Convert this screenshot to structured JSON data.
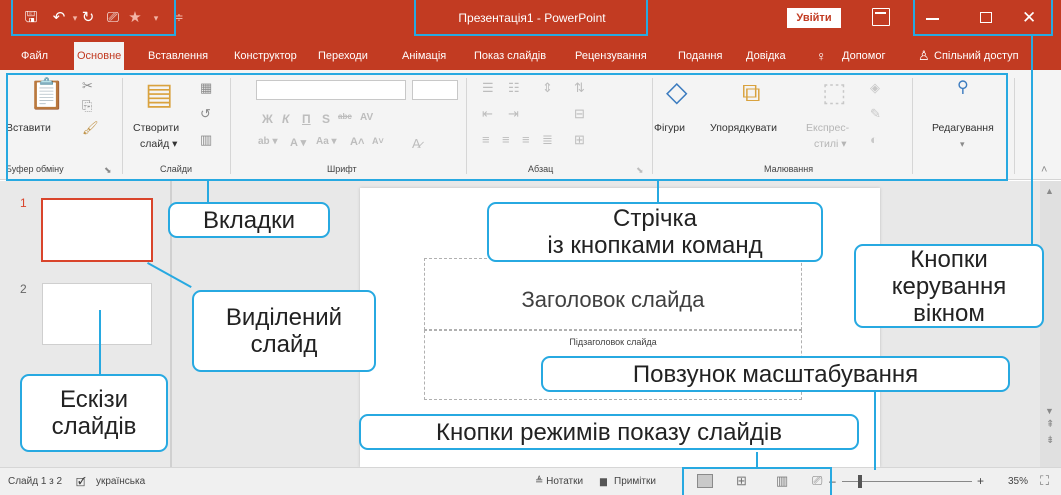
{
  "titlebar": {
    "document_title": "Презентація1  -  PowerPoint",
    "login_label": "Увійти",
    "close_glyph": "✕"
  },
  "tabs": [
    {
      "label": "Файл"
    },
    {
      "label": "Основне",
      "active": true
    },
    {
      "label": "Вставлення"
    },
    {
      "label": "Конструктор"
    },
    {
      "label": "Переходи"
    },
    {
      "label": "Анімація"
    },
    {
      "label": "Показ слайдів"
    },
    {
      "label": "Рецензування"
    },
    {
      "label": "Подання"
    },
    {
      "label": "Довідка"
    },
    {
      "label": "Допомог"
    },
    {
      "label": "Спільний доступ"
    }
  ],
  "ribbon": {
    "paste_label": "Вставити",
    "new_slide_label_1": "Створити",
    "new_slide_label_2": "слайд ▾",
    "shapes_label": "Фігури",
    "arrange_label": "Упорядкувати",
    "quick_styles_label_1": "Експрес-",
    "quick_styles_label_2": "стилі ▾",
    "editing_label": "Редагування",
    "groups": {
      "clipboard": "Буфер обміну",
      "slides": "Слайди",
      "font": "Шрифт",
      "paragraph": "Абзац",
      "drawing": "Малювання"
    },
    "font_buttons": [
      "Ж",
      "К",
      "П",
      "S",
      "abc",
      "AV"
    ],
    "font_buttons_row2": [
      "ab ▾",
      "A ▾",
      "Aa ▾",
      "A˄",
      "A˅"
    ]
  },
  "slides": [
    {
      "number": "1",
      "selected": true
    },
    {
      "number": "2",
      "selected": false
    }
  ],
  "slide": {
    "title_placeholder": "Заголовок слайда",
    "subtitle_placeholder": "Підзаголовок слайда"
  },
  "statusbar": {
    "slide_counter": "Слайд 1 з 2",
    "language": "українська",
    "notes_label": "≜ Нотатки",
    "comments_label": "Примітки",
    "zoom_minus": "–",
    "zoom_plus": "+",
    "zoom_value": "35%",
    "zoom_level_percent": 35
  },
  "callouts": {
    "tabs": "Вкладки",
    "ribbon_line1": "Стрічка",
    "ribbon_line2": "із кнопками команд",
    "window_controls_line1": "Кнопки",
    "window_controls_line2": "керування",
    "window_controls_line3": "вікном",
    "selected_slide_line1": "Виділений",
    "selected_slide_line2": "слайд",
    "zoom_slider": "Повзунок масштабування",
    "thumbnails_line1": "Ескізи",
    "thumbnails_line2": "слайдів",
    "view_buttons": "Кнопки режимів показу слайдів"
  },
  "colors": {
    "accent": "#c23b22",
    "callout_border": "#27a9e1",
    "selected_slide_border": "#d9442b"
  },
  "icons": {
    "save": "save-icon",
    "undo": "undo-icon",
    "redo": "redo-icon",
    "present": "present-from-start-icon",
    "customize": "customize-qat-icon",
    "lightbulb": "lightbulb-icon",
    "share": "share-person-icon",
    "paste": "clipboard-paste-icon",
    "cut": "scissors-icon",
    "shapes": "shapes-icon",
    "arrange": "arrange-icon",
    "search": "search-icon"
  }
}
